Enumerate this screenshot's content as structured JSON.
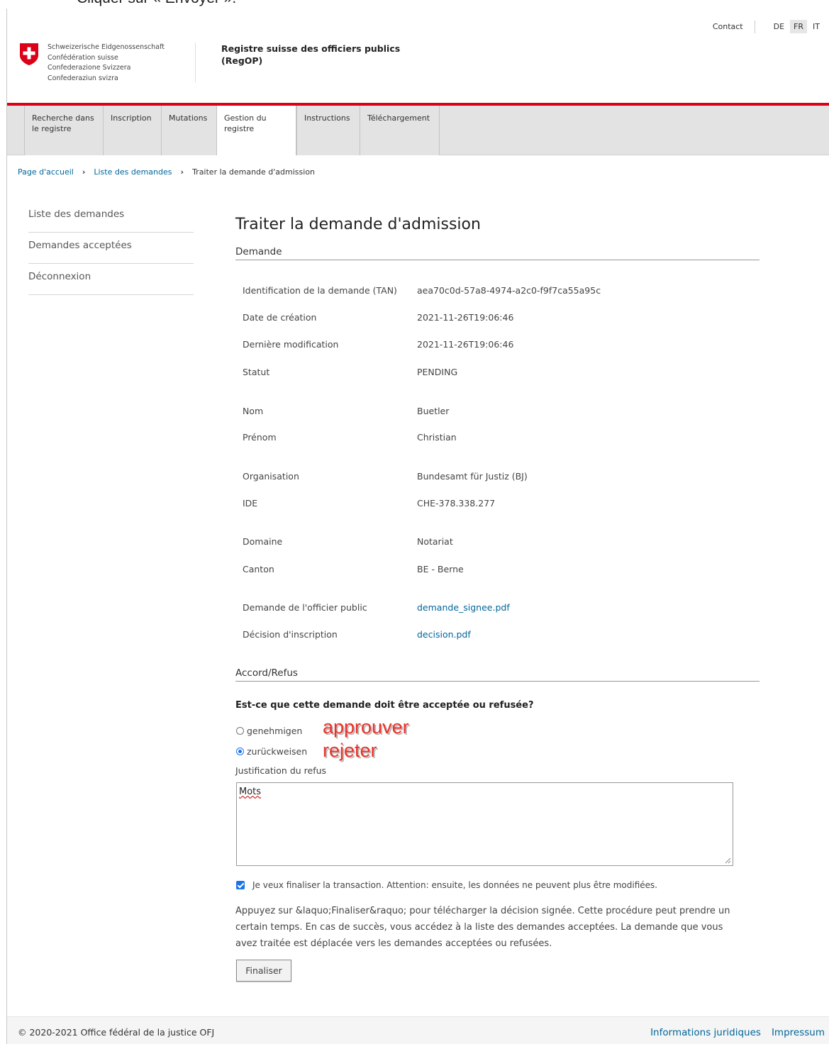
{
  "top_caption": "Cliquer sur « Envoyer ».",
  "lang_bar": {
    "contact": "Contact",
    "languages": [
      "DE",
      "FR",
      "IT"
    ],
    "active": "FR"
  },
  "header": {
    "logo_lines": [
      "Schweizerische Eidgenossenschaft",
      "Confédération suisse",
      "Confederazione Svizzera",
      "Confederaziun svizra"
    ],
    "title_line1": "Registre suisse des officiers publics",
    "title_line2": "(RegOP)"
  },
  "nav": {
    "items": [
      {
        "line1": "Recherche dans",
        "line2": "le registre"
      },
      {
        "line1": "Inscription",
        "line2": ""
      },
      {
        "line1": "Mutations",
        "line2": ""
      },
      {
        "line1": "Gestion du",
        "line2": "registre"
      },
      {
        "line1": "Instructions",
        "line2": ""
      },
      {
        "line1": "Téléchargement",
        "line2": ""
      }
    ]
  },
  "breadcrumb": [
    "Page d'accueil",
    "Liste des demandes",
    "Traiter la demande d'admission"
  ],
  "sidebar": {
    "items": [
      "Liste des demandes",
      "Demandes acceptées",
      "Déconnexion"
    ]
  },
  "main": {
    "title": "Traiter la demande d'admission",
    "section_request": "Demande",
    "fields": [
      {
        "label": "Identification de la demande (TAN)",
        "value": "aea70c0d-57a8-4974-a2c0-f9f7ca55a95c"
      },
      {
        "label": "Date de création",
        "value": "2021-11-26T19:06:46"
      },
      {
        "label": "Dernière modification",
        "value": "2021-11-26T19:06:46"
      },
      {
        "label": "Statut",
        "value": "PENDING"
      },
      {
        "label": "Nom",
        "value": "Buetler"
      },
      {
        "label": "Prénom",
        "value": "Christian"
      },
      {
        "label": "Organisation",
        "value": "Bundesamt für Justiz (BJ)"
      },
      {
        "label": "IDE",
        "value": "CHE-378.338.277"
      },
      {
        "label": "Domaine",
        "value": "Notariat"
      },
      {
        "label": "Canton",
        "value": "BE - Berne"
      },
      {
        "label": "Demande de l'officier public",
        "value": "demande_signee.pdf"
      },
      {
        "label": "Décision d'inscription",
        "value": "decision.pdf"
      }
    ],
    "section_decision": "Accord/Refus",
    "question": "Est-ce que cette demande doit être acceptée ou refusée?",
    "radios": [
      {
        "label": "genehmigen",
        "checked": false,
        "annotation": "approuver"
      },
      {
        "label": "zurückweisen",
        "checked": true,
        "annotation": "rejeter"
      }
    ],
    "justification_label": "Justification du refus",
    "justification_value": "Mots",
    "finalize_check_label": "Je veux finaliser la transaction. Attention: ensuite, les données ne peuvent plus être modifiées.",
    "info_text": "Appuyez sur &laquo;Finaliser&raquo; pour télécharger la décision signée. Cette procédure peut prendre un certain temps. En cas de succès, vous accédez à la liste des demandes acceptées. La demande que vous avez traitée est déplacée vers les demandes acceptées ou refusées.",
    "finalize_button": "Finaliser"
  },
  "footer": {
    "copyright": "© 2020-2021 Office fédéral de la justice OFJ",
    "links": [
      "Informations juridiques",
      "Impressum"
    ]
  },
  "colors": {
    "swiss_red": "#dc0018",
    "link_blue": "#006699",
    "annotation_red": "#e8332a",
    "control_blue": "#1a73e8"
  }
}
